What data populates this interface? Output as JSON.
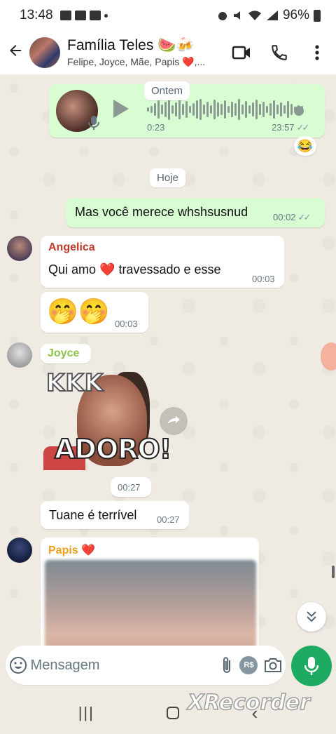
{
  "status_bar": {
    "time": "13:48",
    "battery_percent": "96%"
  },
  "header": {
    "title": "Família Teles 🍉🍻",
    "subtitle": "Felipe, Joyce, Mãe, Papis ❤️,..."
  },
  "chat": {
    "voice_message": {
      "duration": "0:23",
      "time": "23:57",
      "reaction": "😂",
      "status": "read"
    },
    "day_yesterday": "Ontem",
    "day_today": "Hoje",
    "messages": [
      {
        "id": "m1",
        "direction": "out",
        "text": "Mas você merece whshsusnud",
        "time": "00:02",
        "status": "read"
      },
      {
        "id": "m2",
        "direction": "in",
        "sender": "Angelica",
        "sender_color": "#c0392b",
        "text": "Qui amo ❤️ travessado e esse",
        "time": "00:03"
      },
      {
        "id": "m3",
        "direction": "in",
        "sender": "",
        "text": "🤭🤭",
        "time": "00:03"
      },
      {
        "id": "m4",
        "direction": "in",
        "sender": "Joyce",
        "sender_color": "#8bc34a",
        "sticker_top": "KKK",
        "sticker_bottom": "ADORO!",
        "time": "00:27"
      },
      {
        "id": "m5",
        "direction": "in",
        "sender": "",
        "text": "Tuane é terrível",
        "time": "00:27"
      },
      {
        "id": "m6",
        "direction": "in",
        "sender": "Papis ❤️",
        "sender_color": "#f0a020",
        "media": "image"
      }
    ]
  },
  "composer": {
    "placeholder": "Mensagem",
    "currency_label": "R$"
  },
  "watermark": "XRecorder",
  "colors": {
    "accent": "#1daa61",
    "outgoing_bubble": "#d9fdd3",
    "background": "#efeae2"
  }
}
